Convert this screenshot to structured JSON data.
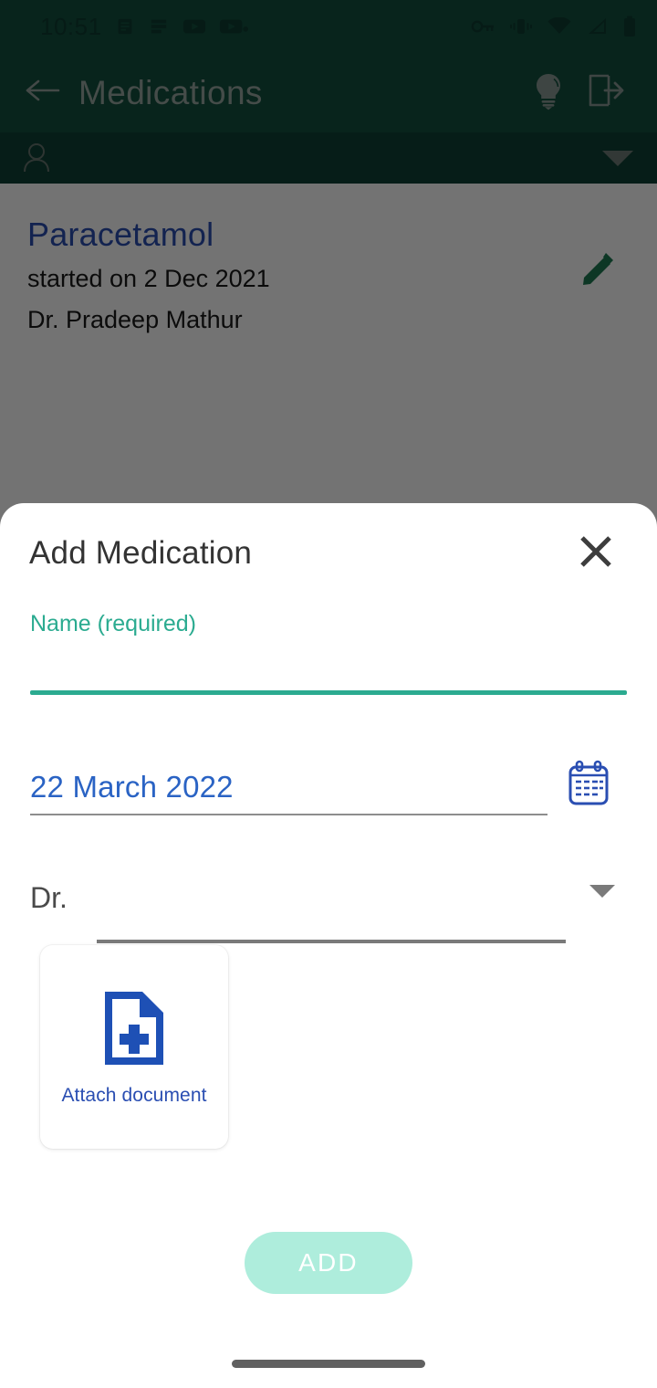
{
  "colors": {
    "app_bar_green": "#12503f",
    "sub_header_green": "#0f4235",
    "accent_teal": "#2bab90",
    "link_blue": "#2a4eb2",
    "date_blue": "#2a63c4",
    "add_button_disabled": "#aeeddc",
    "scrim": "rgba(0,0,0,0.55)"
  },
  "status_bar": {
    "time": "10:51",
    "left_icons": [
      "notes-icon",
      "text-lines-icon",
      "youtube-icon",
      "youtube-music-icon"
    ],
    "right_icons": [
      "vpn-key-icon",
      "vibrate-icon",
      "wifi-icon",
      "cellular-signal-icon",
      "battery-icon"
    ]
  },
  "app_bar": {
    "back_icon": "arrow-left-icon",
    "title": "Medications",
    "actions": [
      {
        "icon": "lightbulb-icon",
        "name": "tips-button"
      },
      {
        "icon": "logout-icon",
        "name": "logout-button"
      }
    ]
  },
  "sub_header": {
    "person_icon": "person-icon",
    "caret_icon": "chevron-down-icon"
  },
  "medication_list": [
    {
      "name": "Paracetamol",
      "started": "started on 2 Dec 2021",
      "doctor": "Dr. Pradeep Mathur",
      "edit_icon": "pencil-icon"
    }
  ],
  "sheet": {
    "title": "Add Medication",
    "close_icon": "close-icon",
    "name_field": {
      "label": "Name (required)",
      "value": "",
      "placeholder": ""
    },
    "date_field": {
      "value": "22 March 2022",
      "calendar_icon": "calendar-icon"
    },
    "doctor_field": {
      "prefix": "Dr.",
      "value": "",
      "caret_icon": "chevron-down-icon"
    },
    "attach": {
      "label": "Attach document",
      "icon": "document-add-icon"
    },
    "submit_label": "ADD"
  },
  "nav": {
    "gesture_handle": "home-gesture-bar"
  }
}
